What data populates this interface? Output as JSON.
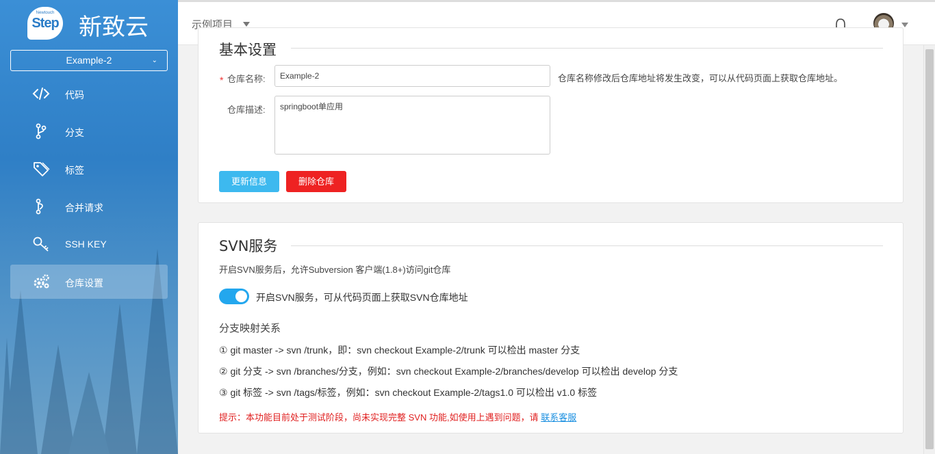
{
  "brand": {
    "logo_small": "Newtouch",
    "logo_big": "Step",
    "name": "新致云"
  },
  "repo_select": {
    "value": "Example-2"
  },
  "nav": [
    {
      "label": "代码",
      "icon": "code-icon"
    },
    {
      "label": "分支",
      "icon": "branch-icon"
    },
    {
      "label": "标签",
      "icon": "tag-icon"
    },
    {
      "label": "合并请求",
      "icon": "merge-request-icon"
    },
    {
      "label": "SSH KEY",
      "icon": "key-icon"
    },
    {
      "label": "仓库设置",
      "icon": "gears-icon",
      "active": true
    }
  ],
  "topbar": {
    "project": "示例项目"
  },
  "basic": {
    "title": "基本设置",
    "required_mark": "*",
    "name_label": "仓库名称:",
    "name_value": "Example-2",
    "name_hint": "仓库名称修改后仓库地址将发生改变，可以从代码页面上获取仓库地址。",
    "desc_label": "仓库描述:",
    "desc_value": "springboot单应用",
    "update_button": "更新信息",
    "delete_button": "删除仓库"
  },
  "svn": {
    "title": "SVN服务",
    "description": "开启SVN服务后，允许Subversion 客户端(1.8+)访问git仓库",
    "toggle_label": "开启SVN服务，可从代码页面上获取SVN仓库地址",
    "toggle_on": true,
    "mapping_title": "分支映射关系",
    "mappings": [
      "① git master -> svn /trunk，即：svn checkout Example-2/trunk 可以检出 master 分支",
      "② git 分支 -> svn /branches/分支，例如：svn checkout Example-2/branches/develop 可以检出 develop 分支",
      "③ git 标签 -> svn /tags/标签，例如：svn checkout Example-2/tags1.0 可以检出 v1.0 标签"
    ],
    "notice": "提示：本功能目前处于测试阶段，尚未实现完整 SVN 功能,如使用上遇到问题，请 ",
    "notice_link": "联系客服"
  },
  "colors": {
    "sidebar": "#3b8fd6",
    "primary_button": "#3db9ef",
    "danger_button": "#ee2222",
    "toggle": "#23a7ee",
    "notice": "#e02020"
  }
}
